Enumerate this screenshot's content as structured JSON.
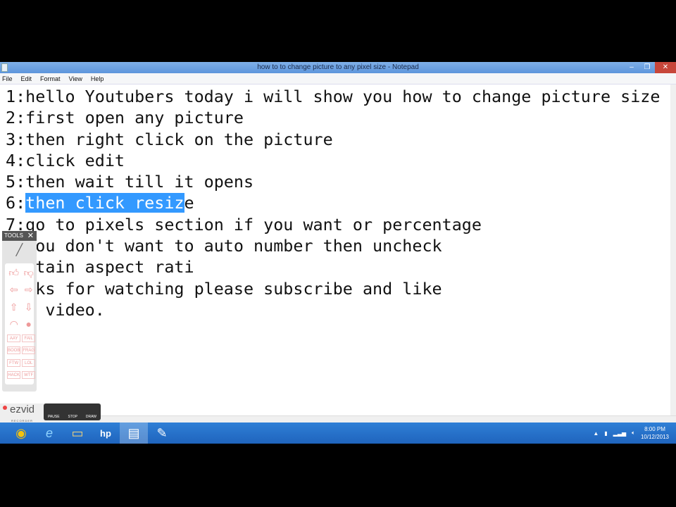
{
  "window": {
    "title": "how to to change picture to any pixel size - Notepad",
    "minimize": "–",
    "restore": "❐",
    "close": "✕"
  },
  "menu": [
    "File",
    "Edit",
    "Format",
    "View",
    "Help"
  ],
  "editor": {
    "lines": [
      "1:hello Youtubers today i will show you how to change picture size",
      "2:first open any picture",
      "3:then right click on the picture",
      "4:click edit",
      "5:then wait till it opens"
    ],
    "line6_prefix": "6:",
    "line6_selected": "then click resiz",
    "line6_suffix": "e",
    "lines_after": [
      "7:go to pixels section if you want or percentage",
      "  you don't want to auto number then uncheck",
      "  ntain aspect rati",
      "  nks for watching please subscribe and like",
      "  s video."
    ]
  },
  "tools_panel": {
    "title": "TOOLS",
    "close": "✕",
    "stamps": [
      "AAY",
      "FAIL",
      "BOOB",
      "FRAG",
      "FTW",
      "LOL",
      "HACK",
      "WTF"
    ]
  },
  "recorder": {
    "logo": "ezvid",
    "sub": "RECORDER",
    "buttons": [
      "PAUSE",
      "STOP",
      "DRAW"
    ]
  },
  "taskbar": {
    "apps": [
      {
        "name": "chrome",
        "glyph": "◉"
      },
      {
        "name": "internet-explorer",
        "glyph": "e"
      },
      {
        "name": "file-explorer",
        "glyph": "▭"
      },
      {
        "name": "hp",
        "glyph": "hp"
      },
      {
        "name": "notepad",
        "glyph": "▤"
      },
      {
        "name": "paint",
        "glyph": "✎"
      }
    ],
    "clock": {
      "time": "8:00 PM",
      "date": "10/12/2013"
    }
  },
  "colors": {
    "selection": "#3399ff",
    "taskbar": "#2a74cf",
    "titlebar": "#6fa3e3"
  }
}
